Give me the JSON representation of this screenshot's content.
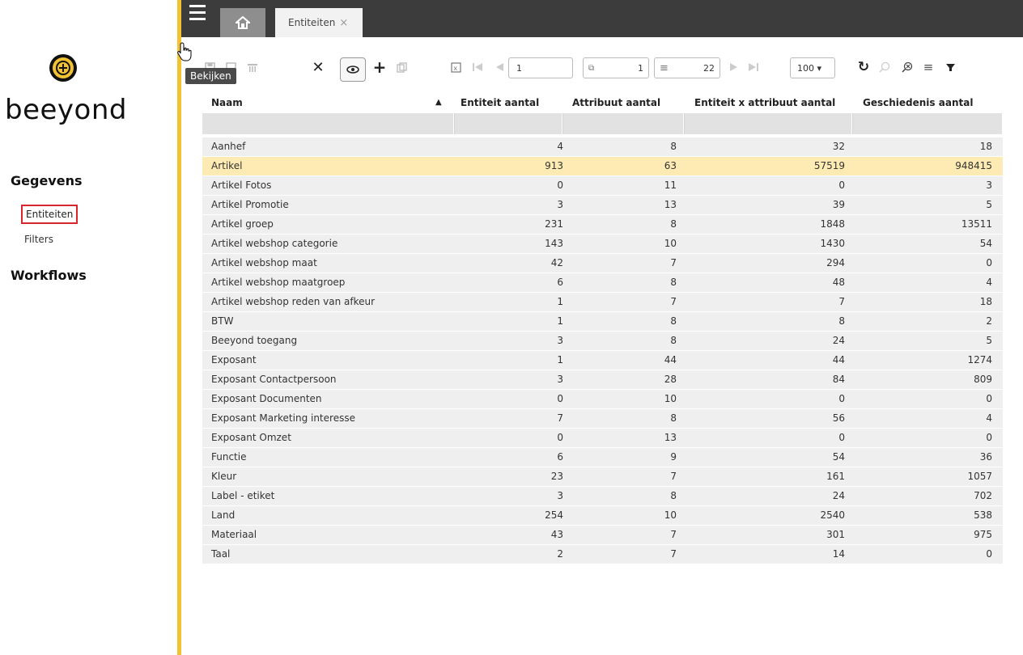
{
  "app": {
    "logo_text": "beeyond",
    "brand_color": "#f3c232",
    "accent_color": "#d9262c"
  },
  "sidebar": {
    "sections": [
      {
        "label": "Gegevens",
        "items": [
          {
            "label": "Entiteiten",
            "active": true
          },
          {
            "label": "Filters",
            "active": false
          }
        ]
      },
      {
        "label": "Workflows",
        "items": []
      }
    ]
  },
  "topbar": {
    "menu_icon": "hamburger-icon",
    "home_icon": "home-icon",
    "tab": {
      "label": "Entiteiten",
      "close": "×"
    }
  },
  "toolbar": {
    "page_input": "1",
    "page_current": "1",
    "page_total": "22",
    "page_size": "100 ▾",
    "tooltip": "Bekijken"
  },
  "table": {
    "columns": [
      "Naam",
      "Entiteit aantal",
      "Attribuut aantal",
      "Entiteit x attribuut aantal",
      "Geschiedenis aantal"
    ],
    "rows": [
      [
        "Aanhef",
        "4",
        "8",
        "32",
        "18"
      ],
      [
        "Artikel",
        "913",
        "63",
        "57519",
        "948415"
      ],
      [
        "Artikel Fotos",
        "0",
        "11",
        "0",
        "3"
      ],
      [
        "Artikel Promotie",
        "3",
        "13",
        "39",
        "5"
      ],
      [
        "Artikel groep",
        "231",
        "8",
        "1848",
        "13511"
      ],
      [
        "Artikel webshop categorie",
        "143",
        "10",
        "1430",
        "54"
      ],
      [
        "Artikel webshop maat",
        "42",
        "7",
        "294",
        "0"
      ],
      [
        "Artikel webshop maatgroep",
        "6",
        "8",
        "48",
        "4"
      ],
      [
        "Artikel webshop reden van afkeur",
        "1",
        "7",
        "7",
        "18"
      ],
      [
        "BTW",
        "1",
        "8",
        "8",
        "2"
      ],
      [
        "Beeyond toegang",
        "3",
        "8",
        "24",
        "5"
      ],
      [
        "Exposant",
        "1",
        "44",
        "44",
        "1274"
      ],
      [
        "Exposant Contactpersoon",
        "3",
        "28",
        "84",
        "809"
      ],
      [
        "Exposant Documenten",
        "0",
        "10",
        "0",
        "0"
      ],
      [
        "Exposant Marketing interesse",
        "7",
        "8",
        "56",
        "4"
      ],
      [
        "Exposant Omzet",
        "0",
        "13",
        "0",
        "0"
      ],
      [
        "Functie",
        "6",
        "9",
        "54",
        "36"
      ],
      [
        "Kleur",
        "23",
        "7",
        "161",
        "1057"
      ],
      [
        "Label - etiket",
        "3",
        "8",
        "24",
        "702"
      ],
      [
        "Land",
        "254",
        "10",
        "2540",
        "538"
      ],
      [
        "Materiaal",
        "43",
        "7",
        "301",
        "975"
      ],
      [
        "Taal",
        "2",
        "7",
        "14",
        "0"
      ]
    ],
    "highlighted_row": 1
  }
}
